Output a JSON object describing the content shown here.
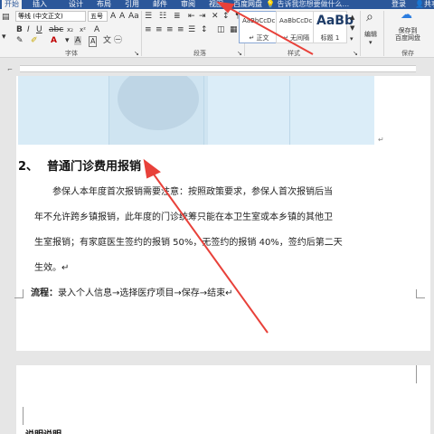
{
  "tabs": [
    "开始",
    "插入",
    "设计",
    "布局",
    "引用",
    "邮件",
    "审阅",
    "视图",
    "百度网盘"
  ],
  "tell_me": "告诉我您想要做什么...",
  "login": "登录",
  "share": "共享",
  "ribbon": {
    "font_name": "等线 (中文正文)",
    "font_size": "五号",
    "groups": {
      "font": "字体",
      "paragraph": "段落",
      "styles": "样式",
      "save": "保存"
    },
    "styles": [
      {
        "sample": "AaBbCcDc",
        "name": "↵ 正文"
      },
      {
        "sample": "AaBbCcDc",
        "name": "↵ 无间隔"
      },
      {
        "sample": "AaBb",
        "name": "标题 1"
      }
    ],
    "editing_label": "编辑",
    "save_baidu": "保存到\n百度网盘"
  },
  "document": {
    "heading_number": "2、",
    "heading_text": "普通门诊费用报销",
    "paragraph_lines": [
      "参保人本年度首次报销需要注意：按照政策要求，参保人首次报销后当",
      "年不允许跨乡镇报销，此年度的门诊统筹只能在本卫生室或本乡镇的其他卫",
      "生室报销；有家庭医生签约的报销 50%，无签约的报销 40%，签约后第二天",
      "生效。↵"
    ],
    "flow_label": "流程：",
    "flow_text": "录入个人信息→选择医疗项目→保存→结束↵",
    "page2_heading": "说明说明"
  },
  "colors": {
    "title_bar": "#2b579a",
    "annotation_arrow": "#e8413a"
  }
}
